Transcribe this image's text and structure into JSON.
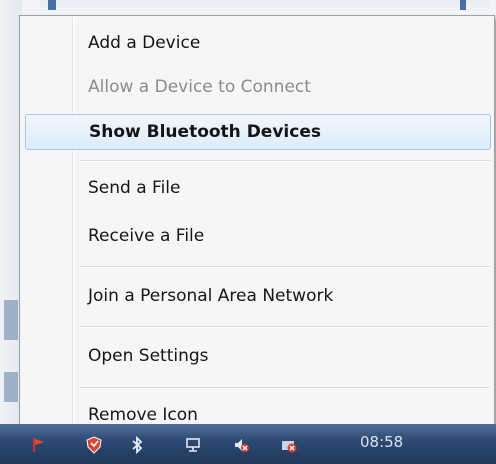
{
  "context_menu": {
    "items": [
      {
        "label": "Add a Device",
        "enabled": true,
        "bold": false,
        "highlighted": false
      },
      {
        "label": "Allow a Device to Connect",
        "enabled": false,
        "bold": false,
        "highlighted": false
      },
      {
        "label": "Show Bluetooth Devices",
        "enabled": true,
        "bold": true,
        "highlighted": true
      },
      {
        "label": "Send a File",
        "enabled": true,
        "bold": false,
        "highlighted": false
      },
      {
        "label": "Receive a File",
        "enabled": true,
        "bold": false,
        "highlighted": false
      },
      {
        "label": "Join a Personal Area Network",
        "enabled": true,
        "bold": false,
        "highlighted": false
      },
      {
        "label": "Open Settings",
        "enabled": true,
        "bold": false,
        "highlighted": false
      },
      {
        "label": "Remove Icon",
        "enabled": true,
        "bold": false,
        "highlighted": false
      }
    ]
  },
  "taskbar": {
    "clock": "08:58",
    "tray_icons": [
      "flag-icon",
      "shield-icon",
      "bluetooth-icon",
      "network-icon",
      "volume-muted-icon",
      "power-error-icon"
    ]
  },
  "colors": {
    "menu_bg": "#f5f6f7",
    "highlight_border": "#a9c6e8",
    "disabled_text": "#8b8b8b",
    "taskbar": "#2f4b74"
  }
}
